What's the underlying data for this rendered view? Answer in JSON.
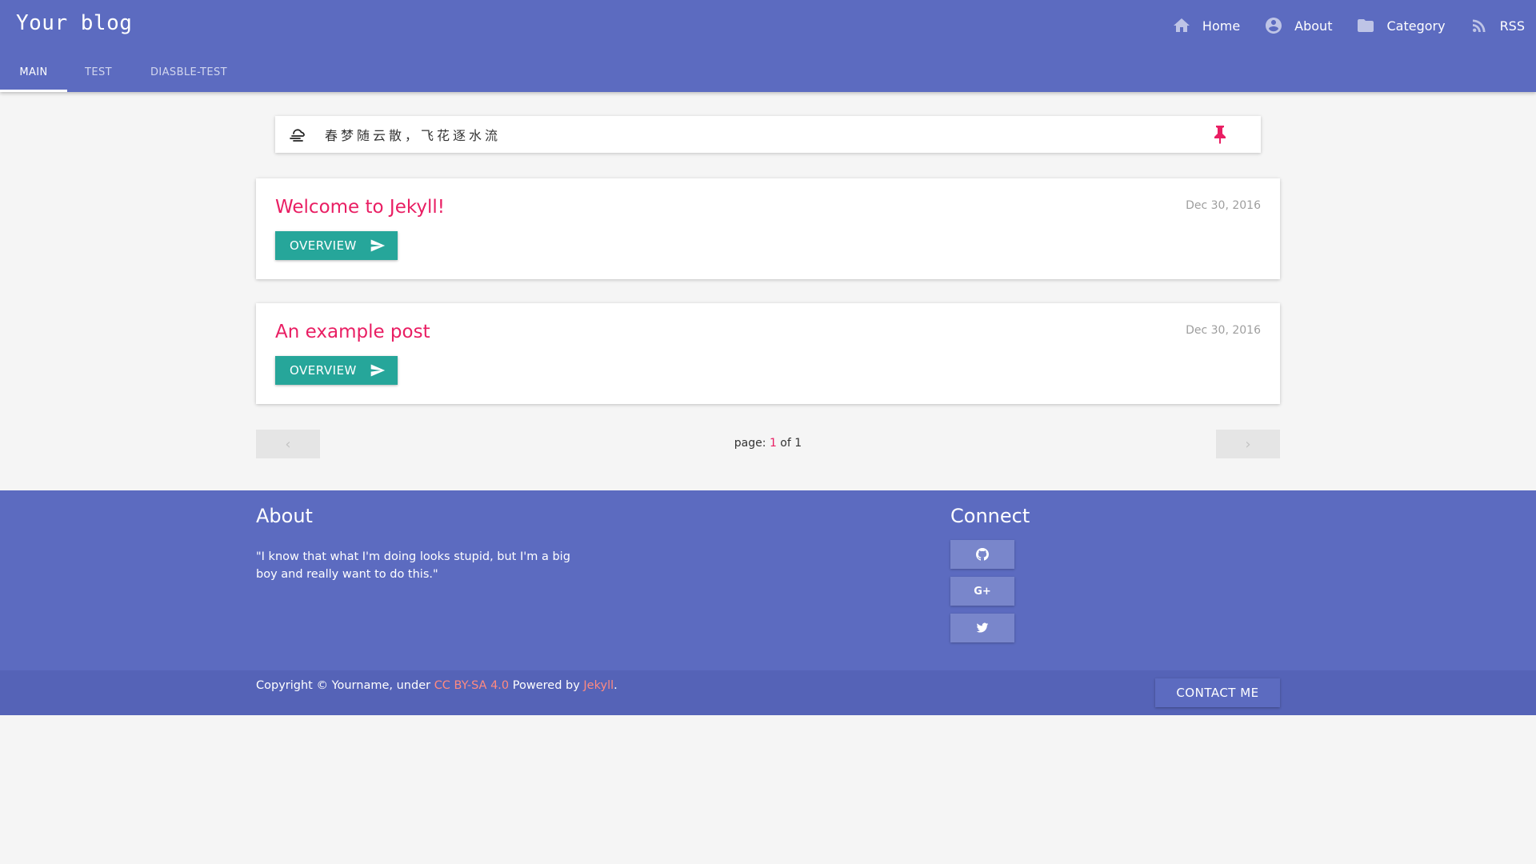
{
  "header": {
    "brand": "Your blog",
    "nav": [
      {
        "label": "Home",
        "icon": "home-icon"
      },
      {
        "label": "About",
        "icon": "account-circle-icon"
      },
      {
        "label": "Category",
        "icon": "folder-icon"
      },
      {
        "label": "RSS",
        "icon": "rss-icon"
      }
    ],
    "tabs": [
      {
        "label": "MAIN",
        "active": true
      },
      {
        "label": "TEST",
        "active": false
      },
      {
        "label": "DIASBLE-TEST",
        "active": false
      }
    ]
  },
  "notice": {
    "text": "春梦随云散，飞花逐水流",
    "left_icon": "cloud-wind-icon",
    "right_icon": "pin-icon"
  },
  "posts": [
    {
      "title": "Welcome to Jekyll!",
      "date": "Dec 30, 2016",
      "button": "OVERVIEW"
    },
    {
      "title": "An example post",
      "date": "Dec 30, 2016",
      "button": "OVERVIEW"
    }
  ],
  "pagination": {
    "prev": "‹",
    "next": "›",
    "prefix": "page: ",
    "current": "1",
    "separator": " of ",
    "total": "1"
  },
  "footer": {
    "about_title": "About",
    "about_text": "\"I know that what I'm doing looks stupid, but I'm a big boy and really want to do this.\"",
    "connect_title": "Connect",
    "social": [
      "github-icon",
      "google-plus-icon",
      "twitter-icon"
    ],
    "gplus_label": "G+",
    "copyright_prefix": "Copyright © Yourname, under ",
    "license": "CC BY-SA 4.0",
    "powered_by": " Powered by ",
    "engine": "Jekyll",
    "end": ".",
    "contact": "CONTACT ME"
  },
  "colors": {
    "primary": "#5c6bc0",
    "accent": "#e91e63",
    "teal": "#26a69a",
    "link": "#ff8a80"
  }
}
